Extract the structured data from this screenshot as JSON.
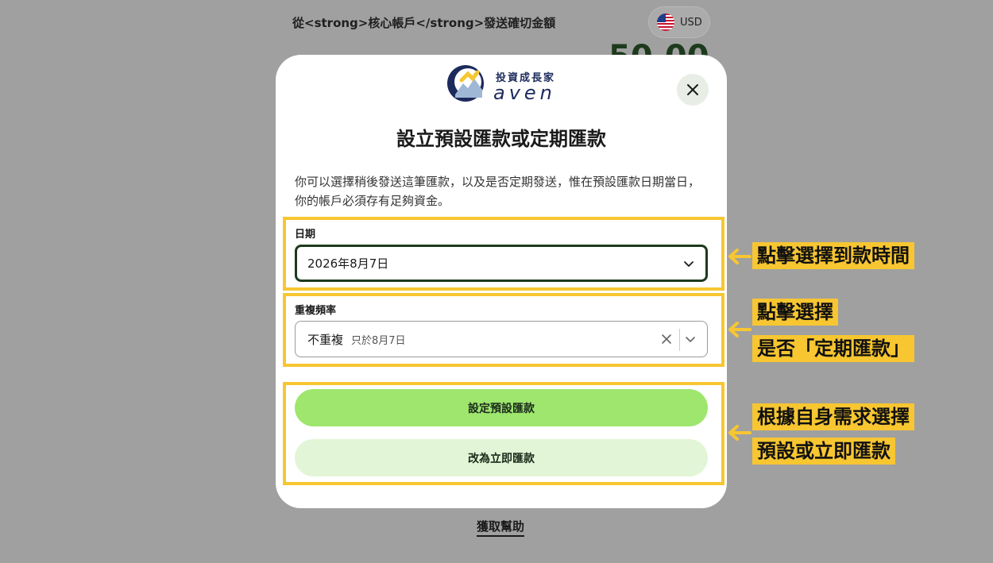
{
  "background": {
    "title": "從<strong>核心帳戶</strong>發送確切金額",
    "currency": "USD",
    "amount": "50.00",
    "help_link": "獲取幫助"
  },
  "modal": {
    "logo_cn": "投資成長家",
    "logo_en": "aven",
    "title": "設立預設匯款或定期匯款",
    "description": "你可以選擇稍後發送這筆匯款，以及是否定期發送，惟在預設匯款日期當日，你的帳戶必須存有足夠資金。",
    "date_label": "日期",
    "date_value": "2026年8月7日",
    "repeat_label": "重複頻率",
    "repeat_value": "不重複",
    "repeat_sub": "只於8月7日",
    "primary_button": "設定預設匯款",
    "secondary_button": "改為立即匯款"
  },
  "annotations": {
    "callout1": "點擊選擇到款時間",
    "callout2_line1": "點擊選擇",
    "callout2_line2": "是否「定期匯款」",
    "callout3_line1": "根據自身需求選擇",
    "callout3_line2": "預設或立即匯款"
  },
  "colors": {
    "highlight": "#f7c631",
    "primary_green": "#9ee66d",
    "light_green": "#e2f5d6",
    "dark_green": "#1d3a1d"
  }
}
